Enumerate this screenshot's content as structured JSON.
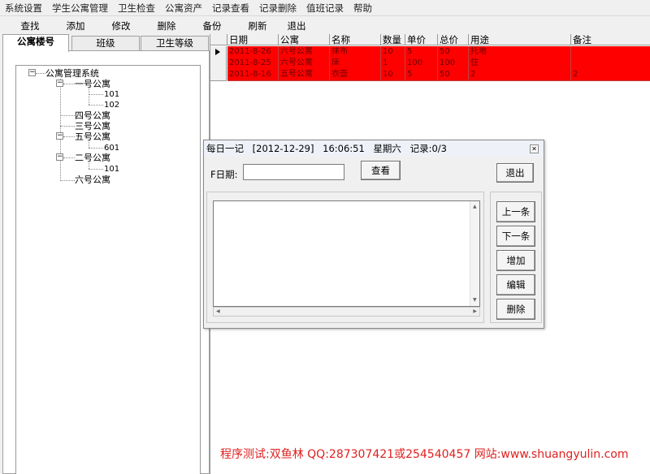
{
  "menu": [
    "系统设置",
    "学生公寓管理",
    "卫生检查",
    "公寓资产",
    "记录查看",
    "记录删除",
    "值班记录",
    "帮助"
  ],
  "toolbar": [
    "查找",
    "添加",
    "修改",
    "删除",
    "备份",
    "刷新",
    "退出"
  ],
  "tabs": [
    "公寓楼号",
    "班级",
    "卫生等级"
  ],
  "tree": {
    "root": "公寓管理系统",
    "n1": "一号公寓",
    "n1_c1": "101",
    "n1_c2": "102",
    "n4": "四号公寓",
    "n3": "三号公寓",
    "n5": "五号公寓",
    "n5_c1": "601",
    "n2": "二号公寓",
    "n2_c1": "101",
    "n6": "六号公寓"
  },
  "grid": {
    "headers": [
      "日期",
      "公寓",
      "名称",
      "数量",
      "单价",
      "总价",
      "用途",
      "备注"
    ],
    "rows": [
      [
        "2011-8-26",
        "六号公寓",
        "抹布",
        "10",
        "5",
        "50",
        "托地",
        ""
      ],
      [
        "2011-8-25",
        "六号公寓",
        "床",
        "1",
        "100",
        "100",
        "住",
        ""
      ],
      [
        "2011-8-16",
        "五号公寓",
        "衣壶",
        "10",
        "5",
        "50",
        "2",
        "2"
      ]
    ],
    "row_color": "#ff0000"
  },
  "dialog": {
    "title": "每日一记",
    "date": "[2012-12-29]",
    "time": "16:06:51",
    "weekday": "星期六",
    "record": "记录:0/3",
    "date_label": "F日期:",
    "date_value": "",
    "view_btn": "查看",
    "exit_btn": "退出",
    "memo": "",
    "side_buttons": [
      "上一条",
      "下一条",
      "增加",
      "编辑",
      "删除"
    ]
  },
  "footer": "程序测试:双鱼林 QQ:287307421或254540457 网站:www.shuangyulin.com"
}
